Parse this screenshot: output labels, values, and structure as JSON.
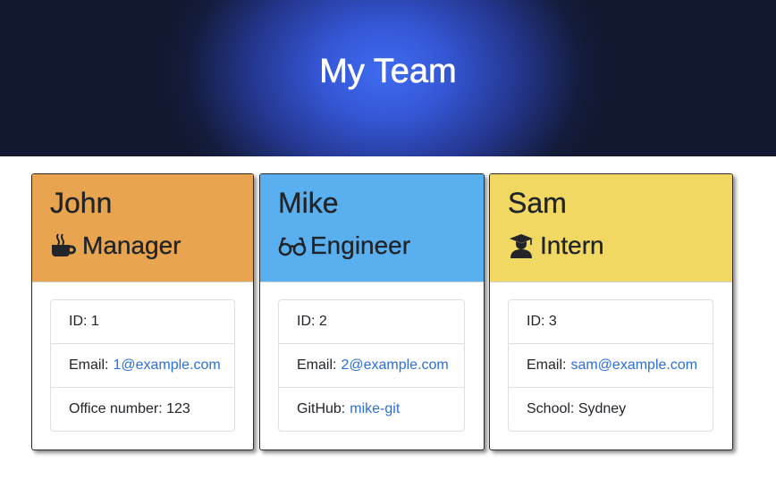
{
  "header": {
    "title": "My Team"
  },
  "colors": {
    "hero_center": "#3f6bf0",
    "hero_edge": "#11182f",
    "manager": "#e8a44e",
    "engineer": "#5ab0ef",
    "intern": "#f0d862",
    "link": "#2c6fd6"
  },
  "team": [
    {
      "name": "John",
      "role": "Manager",
      "icon": "coffee-icon",
      "id_text": "ID: 1",
      "email_label": "Email:",
      "email": "1@example.com",
      "extra_label": "Office number: 123"
    },
    {
      "name": "Mike",
      "role": "Engineer",
      "icon": "glasses-icon",
      "id_text": "ID: 2",
      "email_label": "Email:",
      "email": "2@example.com",
      "extra_label": "GitHub:",
      "extra_link": "mike-git"
    },
    {
      "name": "Sam",
      "role": "Intern",
      "icon": "graduate-icon",
      "id_text": "ID: 3",
      "email_label": "Email:",
      "email": "sam@example.com",
      "extra_label": "School: Sydney"
    }
  ]
}
